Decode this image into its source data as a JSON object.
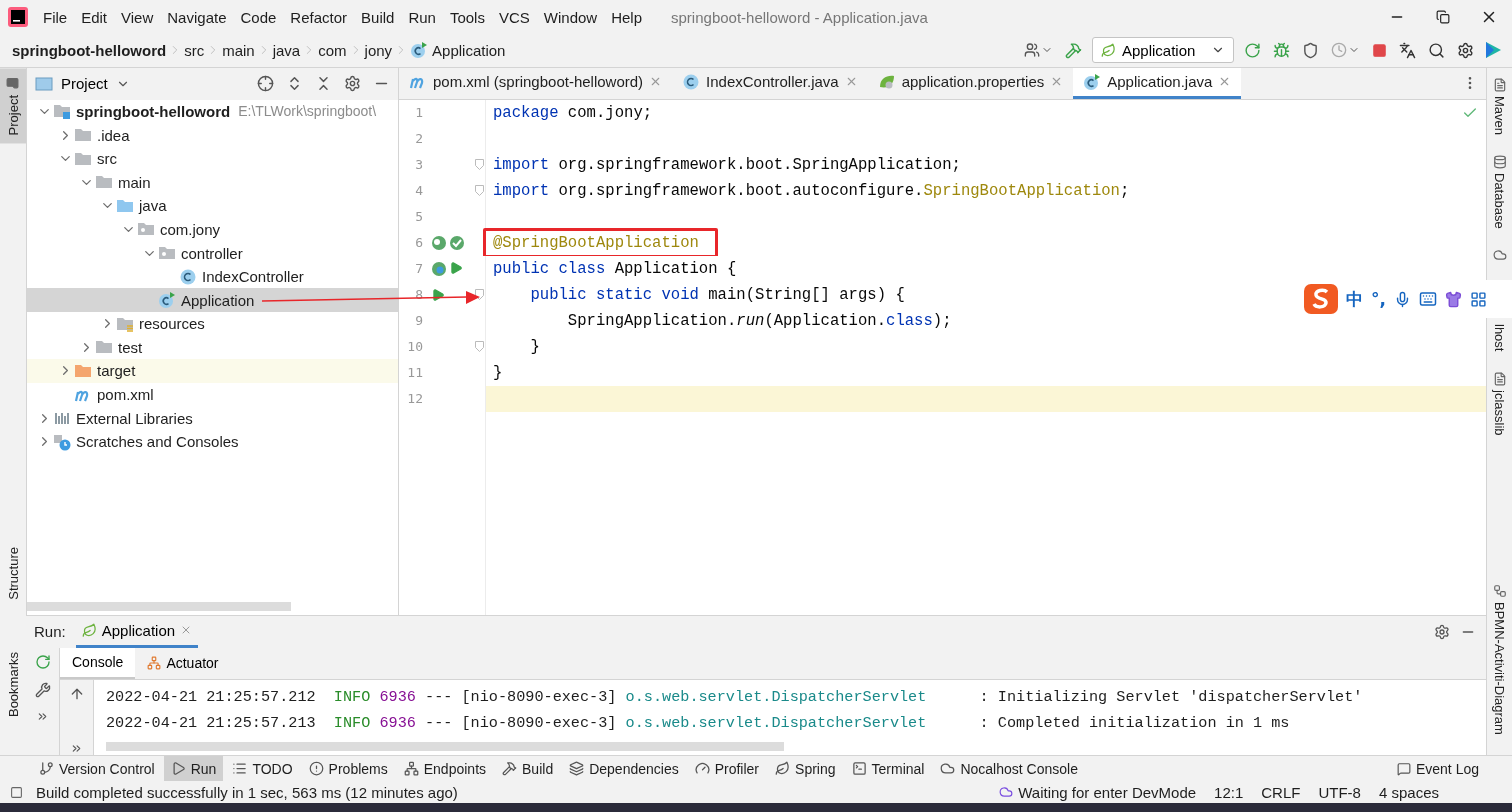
{
  "window": {
    "title": "springboot-helloword - Application.java"
  },
  "menu": [
    "File",
    "Edit",
    "View",
    "Navigate",
    "Code",
    "Refactor",
    "Build",
    "Run",
    "Tools",
    "VCS",
    "Window",
    "Help"
  ],
  "breadcrumbs": [
    {
      "label": "springboot-helloword",
      "kind": "project"
    },
    {
      "label": "src",
      "kind": "folder"
    },
    {
      "label": "main",
      "kind": "folder"
    },
    {
      "label": "java",
      "kind": "folder"
    },
    {
      "label": "com",
      "kind": "folder"
    },
    {
      "label": "jony",
      "kind": "folder"
    },
    {
      "label": "Application",
      "kind": "spring-class"
    }
  ],
  "run_config": {
    "label": "Application"
  },
  "left_stripe": {
    "top": [
      {
        "label": "Project",
        "selected": true
      }
    ],
    "middle": [
      {
        "label": "Structure",
        "selected": false
      }
    ],
    "bottom": [
      {
        "label": "Bookmarks",
        "selected": false
      }
    ]
  },
  "right_stripe": {
    "top": [
      {
        "label": "Maven",
        "kind": "maven"
      },
      {
        "label": "Database",
        "kind": "database"
      },
      {
        "label": "lhost",
        "kind": "cloud"
      },
      {
        "label": "jclasslib",
        "kind": "doc"
      }
    ],
    "bottom": [
      {
        "label": "BPMN-Activiti-Diagram",
        "kind": "diagram"
      }
    ]
  },
  "project_panel": {
    "title": "Project",
    "tree": [
      {
        "label": "springboot-helloword",
        "kind": "module",
        "hint": "E:\\TLWork\\springboot\\",
        "expanded": true,
        "selected": false,
        "children": [
          {
            "label": ".idea",
            "kind": "folder",
            "expanded": false,
            "selected": false
          },
          {
            "label": "src",
            "kind": "folder",
            "expanded": true,
            "selected": false,
            "children": [
              {
                "label": "main",
                "kind": "folder",
                "expanded": true,
                "selected": false,
                "children": [
                  {
                    "label": "java",
                    "kind": "source-folder",
                    "expanded": true,
                    "selected": false,
                    "children": [
                      {
                        "label": "com.jony",
                        "kind": "package",
                        "expanded": true,
                        "selected": false,
                        "children": [
                          {
                            "label": "controller",
                            "kind": "package",
                            "expanded": true,
                            "selected": false,
                            "children": [
                              {
                                "label": "IndexController",
                                "kind": "class",
                                "selected": false
                              }
                            ]
                          },
                          {
                            "label": "Application",
                            "kind": "spring-class",
                            "selected": true
                          }
                        ]
                      }
                    ]
                  },
                  {
                    "label": "resources",
                    "kind": "resources-folder",
                    "expanded": false,
                    "selected": false
                  }
                ]
              },
              {
                "label": "test",
                "kind": "folder",
                "expanded": false,
                "selected": false
              }
            ]
          },
          {
            "label": "target",
            "kind": "excluded-folder",
            "expanded": false,
            "selected": false
          },
          {
            "label": "pom.xml",
            "kind": "maven",
            "selected": false
          }
        ]
      },
      {
        "label": "External Libraries",
        "kind": "libraries",
        "expanded": false,
        "selected": false
      },
      {
        "label": "Scratches and Consoles",
        "kind": "scratches",
        "expanded": false,
        "selected": false
      }
    ]
  },
  "editor": {
    "tabs": [
      {
        "label": "pom.xml (springboot-helloword)",
        "kind": "maven",
        "selected": false
      },
      {
        "label": "IndexController.java",
        "kind": "class",
        "selected": false
      },
      {
        "label": "application.properties",
        "kind": "properties",
        "selected": false
      },
      {
        "label": "Application.java",
        "kind": "spring-class",
        "selected": true
      }
    ],
    "lines": [
      {
        "number": "1",
        "fold": false,
        "current": false,
        "boxed": false,
        "tokens": [
          {
            "kind": "kw",
            "text": "package"
          },
          {
            "kind": "plain",
            "text": " com.jony;"
          }
        ]
      },
      {
        "number": "2",
        "fold": false,
        "current": false,
        "boxed": false
      },
      {
        "number": "3",
        "fold": true,
        "current": false,
        "boxed": false,
        "tokens": [
          {
            "kind": "kw",
            "text": "import"
          },
          {
            "kind": "plain",
            "text": " org.springframework.boot.SpringApplication;"
          }
        ]
      },
      {
        "number": "4",
        "fold": true,
        "current": false,
        "boxed": false,
        "tokens": [
          {
            "kind": "kw",
            "text": "import"
          },
          {
            "kind": "plain",
            "text": " org.springframework.boot.autoconfigure."
          },
          {
            "kind": "annot",
            "text": "SpringBootApplication"
          },
          {
            "kind": "plain",
            "text": ";"
          }
        ]
      },
      {
        "number": "5",
        "fold": false,
        "current": false,
        "boxed": false
      },
      {
        "number": "6",
        "fold": false,
        "current": false,
        "boxed": true,
        "gutter": [
          {
            "kind": "bean"
          },
          {
            "kind": "bean-check"
          }
        ],
        "tokens": [
          {
            "kind": "annot",
            "text": "@SpringBootApplication"
          }
        ]
      },
      {
        "number": "7",
        "fold": false,
        "current": false,
        "boxed": false,
        "gutter": [
          {
            "kind": "spring-run"
          },
          {
            "kind": "run"
          }
        ],
        "tokens": [
          {
            "kind": "kw",
            "text": "public class"
          },
          {
            "kind": "plain",
            "text": " Application {"
          }
        ]
      },
      {
        "number": "8",
        "fold": true,
        "current": false,
        "boxed": false,
        "gutter": [
          {
            "kind": "run"
          }
        ],
        "tokens": [
          {
            "kind": "kw",
            "text": "    public static void"
          },
          {
            "kind": "plain",
            "text": " main(String[] args) {"
          }
        ]
      },
      {
        "number": "9",
        "fold": false,
        "current": false,
        "boxed": false,
        "tokens": [
          {
            "kind": "plain",
            "text": "        SpringApplication."
          },
          {
            "kind": "italic",
            "text": "run"
          },
          {
            "kind": "plain",
            "text": "(Application."
          },
          {
            "kind": "kw",
            "text": "class"
          },
          {
            "kind": "plain",
            "text": ");"
          }
        ]
      },
      {
        "number": "10",
        "fold": true,
        "current": false,
        "boxed": false,
        "tokens": [
          {
            "kind": "plain",
            "text": "    }"
          }
        ]
      },
      {
        "number": "11",
        "fold": false,
        "current": false,
        "boxed": false,
        "tokens": [
          {
            "kind": "plain",
            "text": "}"
          }
        ]
      },
      {
        "number": "12",
        "fold": false,
        "current": true,
        "boxed": false
      }
    ]
  },
  "ime_bar": {
    "labels": [
      "中",
      "°,"
    ]
  },
  "run_panel": {
    "label": "Run:",
    "tabs": [
      {
        "label": "Application"
      }
    ],
    "subtabs": [
      {
        "label": "Console",
        "kind": "console",
        "selected": true
      },
      {
        "label": "Actuator",
        "kind": "actuator",
        "selected": false
      }
    ],
    "log": [
      {
        "timestamp": "2022-04-21 21:25:57.212",
        "level": "INFO",
        "pid": "6936",
        "thread": "--- [nio-8090-exec-3]",
        "logger": "o.s.web.servlet.DispatcherServlet",
        "message": ": Initializing Servlet 'dispatcherServlet'"
      },
      {
        "timestamp": "2022-04-21 21:25:57.213",
        "level": "INFO",
        "pid": "6936",
        "thread": "--- [nio-8090-exec-3]",
        "logger": "o.s.web.servlet.DispatcherServlet",
        "message": ": Completed initialization in 1 ms"
      }
    ]
  },
  "tool_windows": [
    {
      "label": "Version Control",
      "kind": "vcs",
      "selected": false
    },
    {
      "label": "Run",
      "kind": "run",
      "selected": true
    },
    {
      "label": "TODO",
      "kind": "todo",
      "selected": false
    },
    {
      "label": "Problems",
      "kind": "problems",
      "selected": false
    },
    {
      "label": "Endpoints",
      "kind": "endpoints",
      "selected": false
    },
    {
      "label": "Build",
      "kind": "build",
      "selected": false
    },
    {
      "label": "Dependencies",
      "kind": "dependencies",
      "selected": false
    },
    {
      "label": "Profiler",
      "kind": "profiler",
      "selected": false
    },
    {
      "label": "Spring",
      "kind": "spring",
      "selected": false
    },
    {
      "label": "Terminal",
      "kind": "terminal",
      "selected": false
    },
    {
      "label": "Nocalhost Console",
      "kind": "nocalhost",
      "selected": false
    }
  ],
  "event_log": {
    "label": "Event Log"
  },
  "status_bar": {
    "message": "Build completed successfully in 1 sec, 563 ms (12 minutes ago)",
    "items": [
      {
        "label": "Waiting for enter DevMode",
        "kind": "devmode"
      },
      {
        "label": "12:1",
        "kind": "plain"
      },
      {
        "label": "CRLF",
        "kind": "plain"
      },
      {
        "label": "UTF-8",
        "kind": "plain"
      },
      {
        "label": "4 spaces",
        "kind": "plain"
      }
    ]
  }
}
